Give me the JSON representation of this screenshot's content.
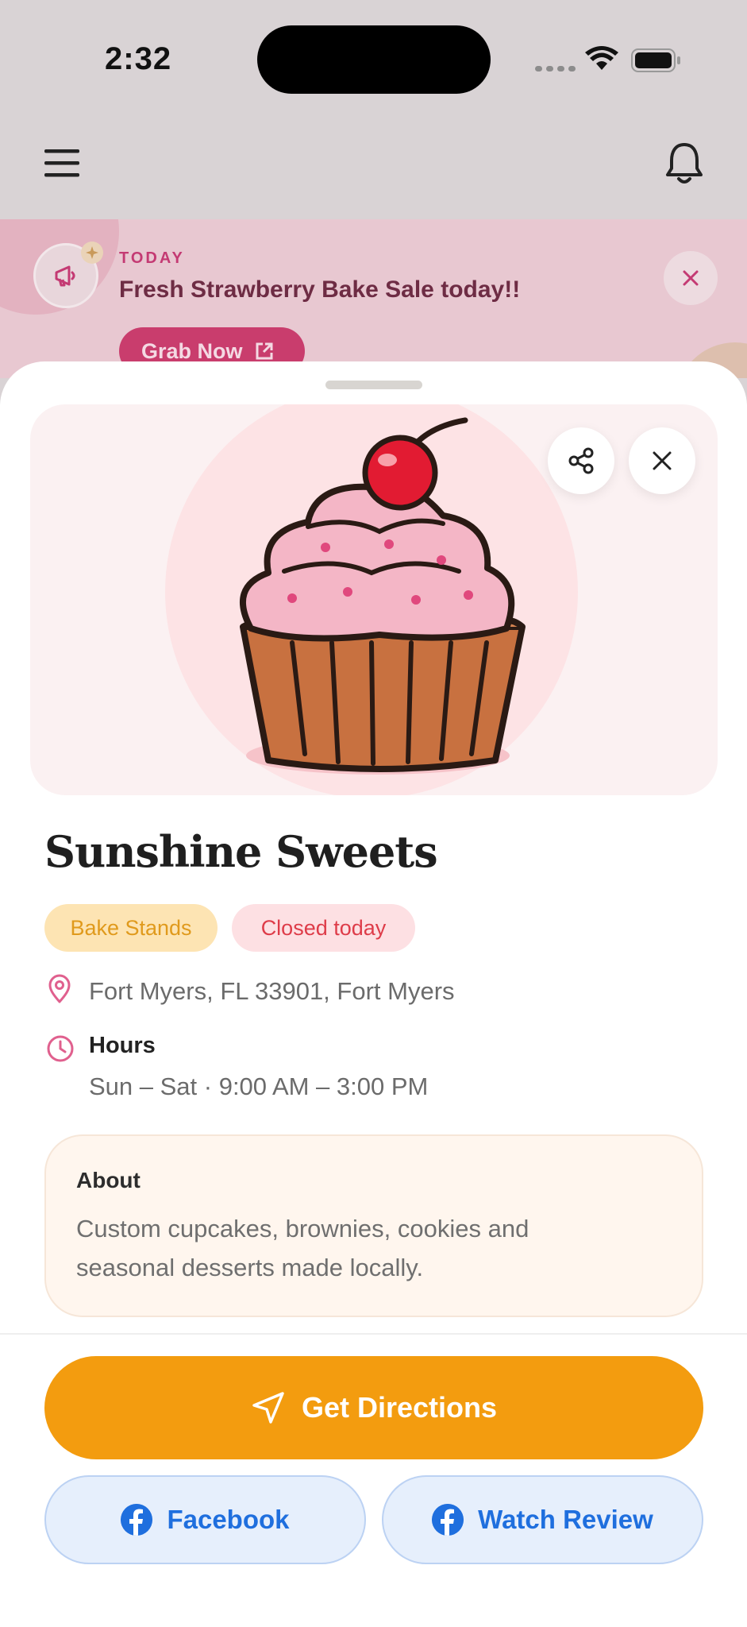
{
  "status_bar": {
    "time": "2:32"
  },
  "promo": {
    "eyebrow": "TODAY",
    "title": "Fresh Strawberry Bake Sale today!!",
    "cta_label": "Grab Now"
  },
  "shop": {
    "name": "Sunshine Sweets",
    "category": "Bake Stands",
    "status": "Closed today",
    "address": "Fort Myers, FL 33901, Fort Myers",
    "hours_label": "Hours",
    "hours": "Sun – Sat · 9:00 AM – 3:00 PM",
    "about_title": "About",
    "about_text": "Custom cupcakes, brownies, cookies and seasonal desserts made locally."
  },
  "actions": {
    "directions_label": "Get Directions",
    "facebook_label": "Facebook",
    "review_label": "Watch Review"
  },
  "colors": {
    "primary": "#f39c0f",
    "promo_accent": "#c93d6d",
    "status_red": "#de3c49",
    "link_blue": "#1f6fde"
  }
}
